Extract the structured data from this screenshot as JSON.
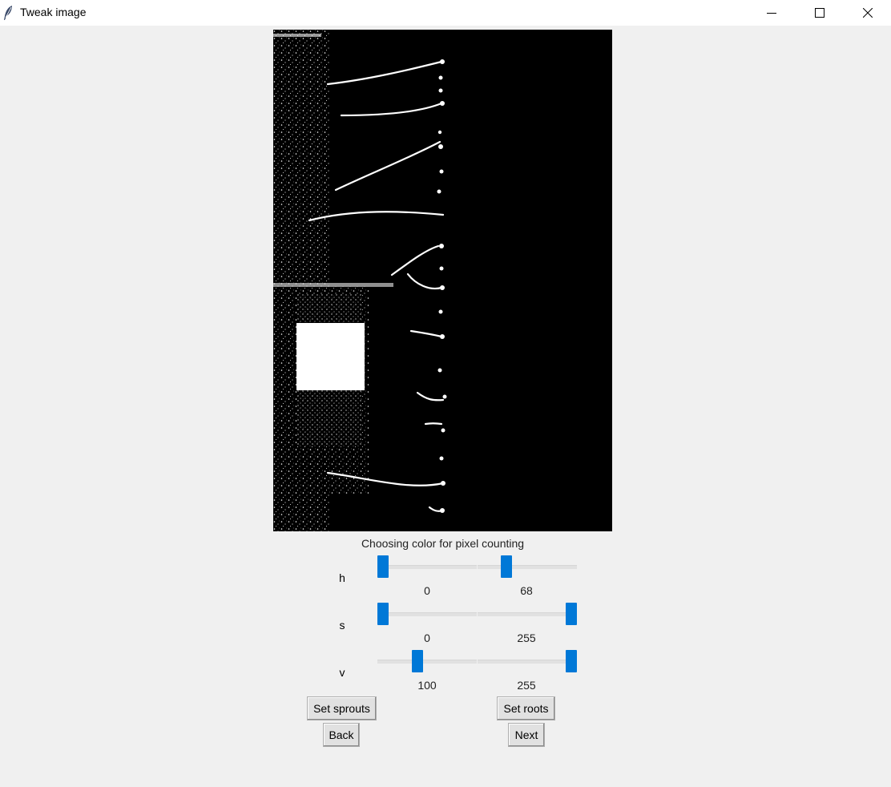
{
  "window": {
    "title": "Tweak image",
    "controls": [
      "minimize-icon",
      "maximize-icon",
      "close-icon"
    ]
  },
  "image": {
    "description_icon": "processed-binary-image"
  },
  "panel": {
    "caption": "Choosing color for pixel counting",
    "rows": [
      {
        "label": "h",
        "low": 0,
        "high": 68,
        "max": 255
      },
      {
        "label": "s",
        "low": 0,
        "high": 255,
        "max": 255
      },
      {
        "label": "v",
        "low": 100,
        "high": 255,
        "max": 255
      }
    ]
  },
  "buttons": {
    "set_sprouts": "Set sprouts",
    "set_roots": "Set roots",
    "back": "Back",
    "next": "Next"
  },
  "colors": {
    "accent": "#0078d7",
    "background": "#f0f0f0"
  }
}
